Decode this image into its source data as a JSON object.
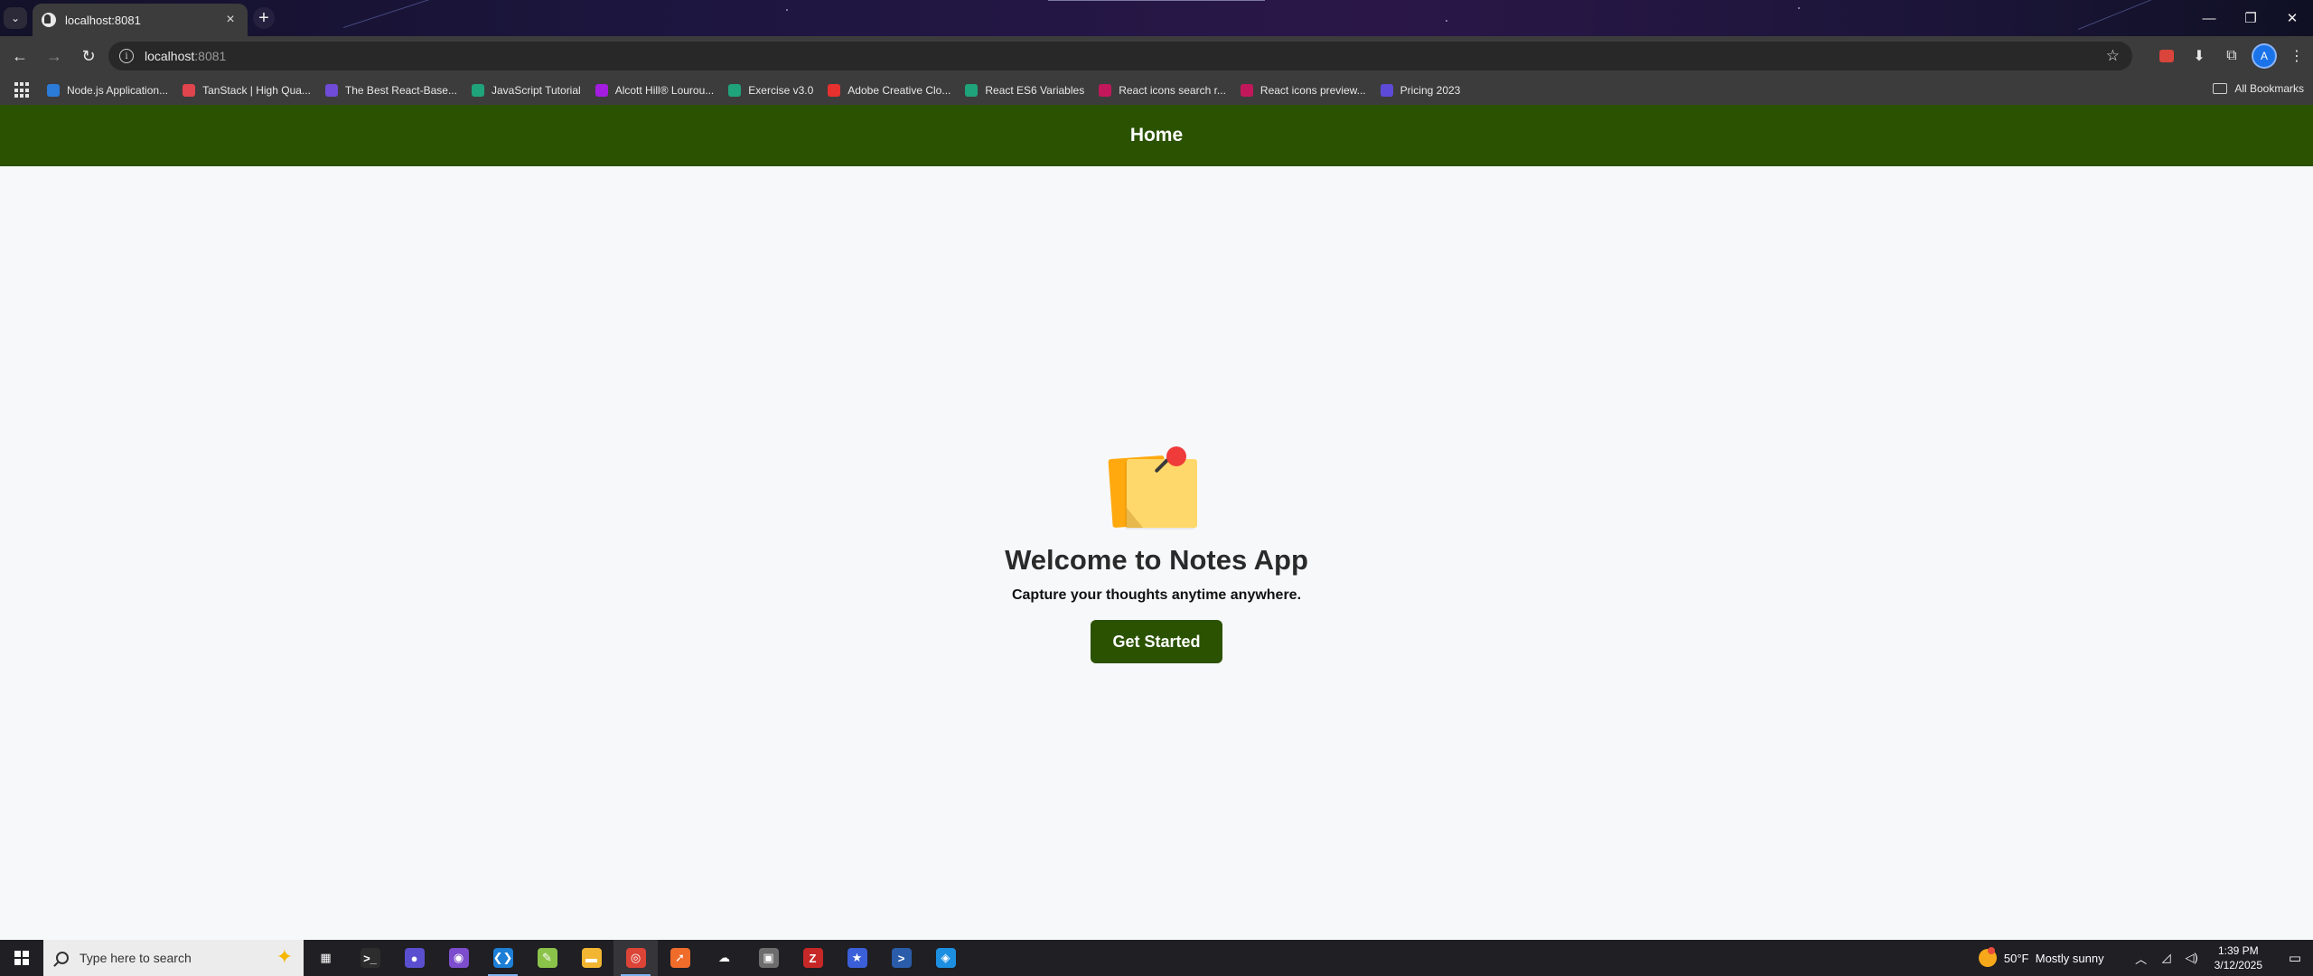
{
  "browser": {
    "tab": {
      "title": "localhost:8081"
    },
    "address": {
      "host": "localhost",
      "port": ":8081"
    },
    "profile_initial": "A",
    "bookmarks": [
      {
        "label": "Node.js Application...",
        "color": "#2b7bd8"
      },
      {
        "label": "TanStack | High Qua...",
        "color": "#e0444d"
      },
      {
        "label": "The Best React-Base...",
        "color": "#6f4bd8"
      },
      {
        "label": "JavaScript Tutorial",
        "color": "#1fa37a"
      },
      {
        "label": "Alcott Hill® Lourou...",
        "color": "#a41ce0"
      },
      {
        "label": "Exercise v3.0",
        "color": "#1fa37a"
      },
      {
        "label": "Adobe Creative Clo...",
        "color": "#e6312e"
      },
      {
        "label": "React ES6 Variables",
        "color": "#1fa37a"
      },
      {
        "label": "React icons search r...",
        "color": "#c2185b"
      },
      {
        "label": "React icons preview...",
        "color": "#c2185b"
      },
      {
        "label": "Pricing 2023",
        "color": "#5d4bd8"
      }
    ],
    "all_bookmarks_label": "All Bookmarks"
  },
  "app": {
    "header_title": "Home",
    "accent_color": "#2b5200",
    "hero": {
      "icon": "sticky-note-icon",
      "title": "Welcome to Notes App",
      "tagline": "Capture your thoughts anytime anywhere.",
      "cta_label": "Get Started"
    }
  },
  "taskbar": {
    "search_placeholder": "Type here to search",
    "apps": [
      {
        "name": "task-view",
        "glyph": "▦",
        "color": "#1f1f24"
      },
      {
        "name": "terminal",
        "glyph": ">_",
        "color": "#2d2d2d"
      },
      {
        "name": "browser-app",
        "glyph": "●",
        "color": "#5a4fcf"
      },
      {
        "name": "github-desktop",
        "glyph": "◉",
        "color": "#7c4dcc"
      },
      {
        "name": "vscode",
        "glyph": "❮❯",
        "color": "#1d7fd6"
      },
      {
        "name": "notepad-plus",
        "glyph": "✎",
        "color": "#8bc34a"
      },
      {
        "name": "file-explorer",
        "glyph": "▬",
        "color": "#f2b632"
      },
      {
        "name": "chrome",
        "glyph": "◎",
        "color": "#db4437"
      },
      {
        "name": "postman",
        "glyph": "➚",
        "color": "#ef6c2b"
      },
      {
        "name": "cloud-app",
        "glyph": "☁",
        "color": "#1f1f24"
      },
      {
        "name": "photos",
        "glyph": "▣",
        "color": "#6d6d6d"
      },
      {
        "name": "filezilla",
        "glyph": "Z",
        "color": "#c62828"
      },
      {
        "name": "star-app",
        "glyph": "★",
        "color": "#3b5fd8"
      },
      {
        "name": "powershell",
        "glyph": ">",
        "color": "#2a5caa"
      },
      {
        "name": "docker",
        "glyph": "◈",
        "color": "#1d8fe1"
      }
    ],
    "weather": {
      "temp": "50°F",
      "condition": "Mostly sunny"
    },
    "time": "1:39 PM",
    "date": "3/12/2025"
  }
}
